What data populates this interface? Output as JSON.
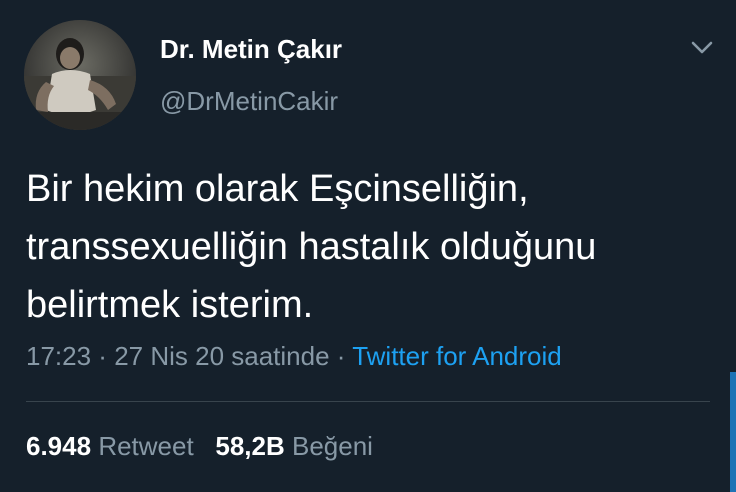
{
  "tweet": {
    "author": {
      "name": "Dr. Metin Çakır",
      "handle": "@DrMetinCakir"
    },
    "text": "Bir hekim olarak Eşcinselliğin,\ntranssexuelliğin hastalık olduğunu\nbelirtmek isterim.",
    "time": "17:23",
    "separator_1": " · ",
    "date": "27 Nis 20 saatinde",
    "separator_2": " · ",
    "source": "Twitter for Android",
    "stats": {
      "retweets_count": "6.948",
      "retweets_label": "Retweet",
      "likes_count": "58,2B",
      "likes_label": "Beğeni"
    }
  },
  "icons": {
    "more": "chevron-down-icon",
    "avatar": "profile-photo"
  },
  "colors": {
    "background": "#15202b",
    "primary_text": "#ffffff",
    "secondary_text": "#8899a6",
    "link": "#1da1f2",
    "divider": "#38444d"
  }
}
